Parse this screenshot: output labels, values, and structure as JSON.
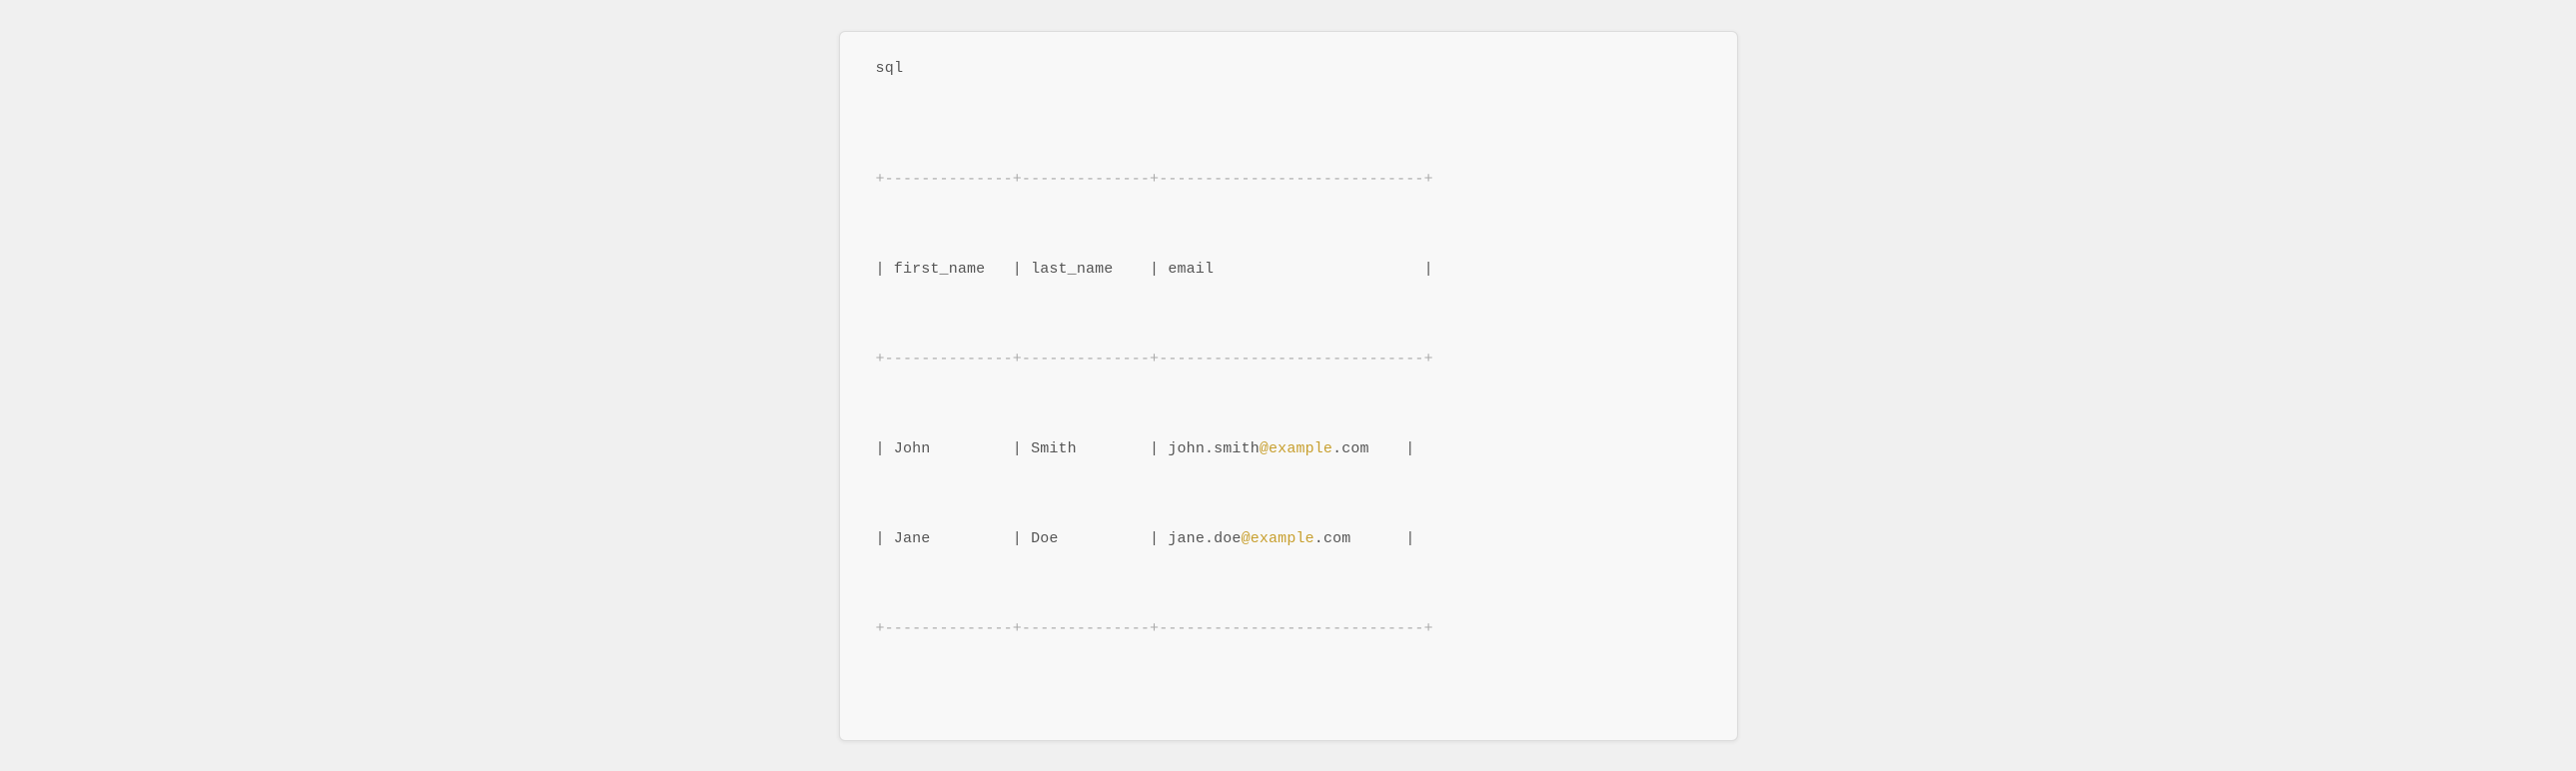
{
  "prompt": {
    "label": "sql"
  },
  "table": {
    "separator": "+--------------+--------------+-----------------------------+",
    "header": "| first_name   | last_name    | email                       |",
    "rows": [
      {
        "first_name": "John",
        "last_name": "Smith",
        "email_before": "john.smith",
        "email_at": "@example",
        "email_after": ".com"
      },
      {
        "first_name": "Jane",
        "last_name": "Doe",
        "email_before": "jane.doe",
        "email_at": "@example",
        "email_after": ".com"
      }
    ]
  }
}
